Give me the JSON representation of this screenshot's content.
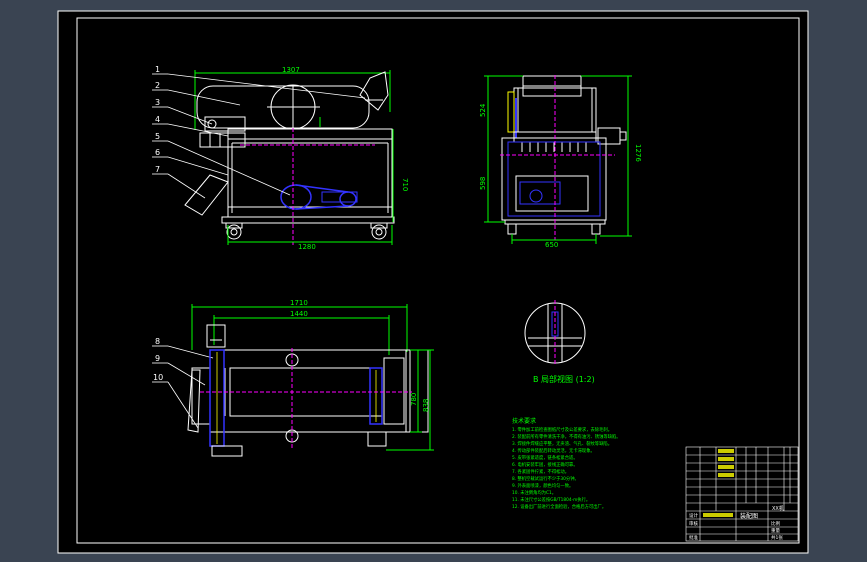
{
  "colors": {
    "background": "#3a4452",
    "sheet": "#000000",
    "outline": "#ffffff",
    "dimension": "#00ff00",
    "centerline": "#ff00ff",
    "belt": "#3333ff",
    "accent": "#ffff00"
  },
  "callouts": [
    "1",
    "2",
    "3",
    "4",
    "5",
    "6",
    "7",
    "8",
    "9",
    "10"
  ],
  "front_view": {
    "dims": {
      "overall_length": "1307",
      "wheelbase": "1280",
      "height": "710"
    }
  },
  "side_view": {
    "dims": {
      "upper_height": "524",
      "lower_height": "598",
      "total_height": "1276",
      "width": "650"
    }
  },
  "top_view": {
    "dims": {
      "overall_length": "1710",
      "inner_length": "1440",
      "depth_outer": "838",
      "depth_inner": "780"
    }
  },
  "detail_view": {
    "label": "B 局部视图 (1:2)"
  },
  "notes": {
    "heading": "技术要求",
    "lines": [
      "1. 零件加工前检查图纸尺寸及公差要求，去除毛刺。",
      "2. 装配前所有零件清洗干净，不得有油污、锈蚀等缺陷。",
      "3. 焊接件焊缝应平整，无夹渣、气孔、裂纹等缺陷。",
      "4. 传动部件装配后转动灵活，无卡滞现象。",
      "5. 皮带张紧适度，链条松紧合适。",
      "6. 电机安装牢固，接线正确可靠。",
      "7. 各紧固件拧紧，不得松动。",
      "8. 整机空载试运行不少于30分钟。",
      "9. 外表面喷漆，颜色均匀一致。",
      "10. 未注倒角均为C1。",
      "11. 未注尺寸公差按GB/T1804-m执行。",
      "12. 设备出厂前进行全面检验，合格后方可出厂。"
    ]
  },
  "title_block": {
    "drawing_title": "装配图",
    "machine_name": "XX机",
    "field_scale": "比例",
    "field_weight": "重量",
    "field_sheet": "共1张",
    "field_designer": "设计",
    "field_checker": "审核",
    "field_approver": "批准"
  }
}
